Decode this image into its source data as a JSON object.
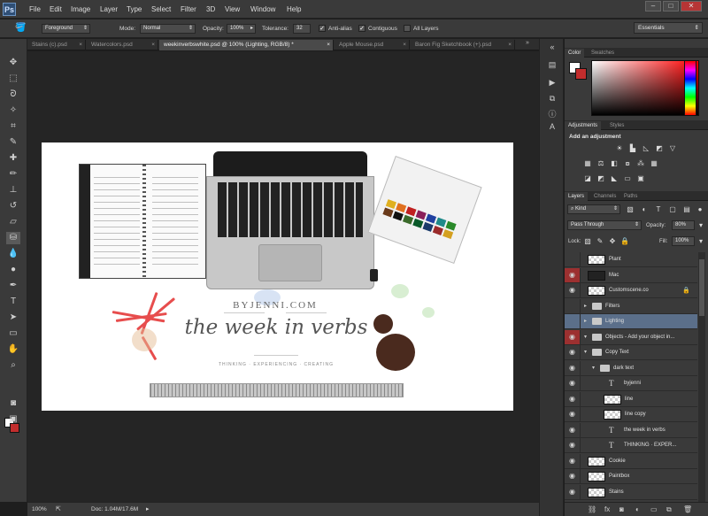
{
  "app": {
    "logo": "Ps"
  },
  "menu": [
    "File",
    "Edit",
    "Image",
    "Layer",
    "Type",
    "Select",
    "Filter",
    "3D",
    "View",
    "Window",
    "Help"
  ],
  "window_controls": {
    "minimize": "–",
    "maximize": "□",
    "close": "✕"
  },
  "options_bar": {
    "fill_source": "Foreground",
    "mode_label": "Mode:",
    "mode_value": "Normal",
    "opacity_label": "Opacity:",
    "opacity_value": "100%",
    "tolerance_label": "Tolerance:",
    "tolerance_value": "32",
    "anti_alias_label": "Anti-alias",
    "contiguous_label": "Contiguous",
    "all_layers_label": "All Layers",
    "anti_alias_checked": true,
    "contiguous_checked": true,
    "all_layers_checked": false
  },
  "workspace": "Essentials",
  "tabs": [
    {
      "label": "Stains (c).psd",
      "active": false
    },
    {
      "label": "Watercolors.psd",
      "active": false
    },
    {
      "label": "weekinverbswhite.psd @ 100% (Lighting, RGB/8) *",
      "active": true
    },
    {
      "label": "Apple Mouse.psd",
      "active": false
    },
    {
      "label": "Baron Fig Sketchbook (+).psd",
      "active": false
    }
  ],
  "tab_close": "×",
  "artwork": {
    "byline": "BYJENNI.COM",
    "title": "the week in verbs",
    "tagline": "THINKING · EXPERIENCING · CREATING"
  },
  "status": {
    "zoom": "100%",
    "doc": "Doc: 1.04M/17.6M"
  },
  "color_panel": {
    "tabs": [
      "Color",
      "Swatches"
    ]
  },
  "adjustments_panel": {
    "tabs": [
      "Adjustments",
      "Styles"
    ],
    "title": "Add an adjustment"
  },
  "layers_panel": {
    "tabs": [
      "Layers",
      "Channels",
      "Paths"
    ],
    "kind_label": "Kind",
    "blend_mode": "Pass Through",
    "opacity_label": "Opacity:",
    "opacity_value": "80%",
    "lock_label": "Lock:",
    "fill_label": "Fill:",
    "fill_value": "100%",
    "layers": [
      {
        "name": "Plant",
        "visible": false,
        "type": "thumb"
      },
      {
        "name": "Mac",
        "visible": false,
        "type": "dark",
        "red": true
      },
      {
        "name": "Customscene.co",
        "visible": true,
        "type": "thumb",
        "locked": true
      },
      {
        "name": "Filters",
        "visible": false,
        "type": "folder"
      },
      {
        "name": "Lighting",
        "visible": false,
        "type": "folder",
        "selected": true
      },
      {
        "name": "Objects - Add your object in...",
        "visible": false,
        "type": "folder",
        "red": true,
        "open": true
      },
      {
        "name": "Copy Text",
        "visible": true,
        "type": "folder",
        "open": true
      },
      {
        "name": "dark text",
        "visible": true,
        "type": "folder",
        "open": true
      },
      {
        "name": "byjenni",
        "visible": true,
        "type": "text"
      },
      {
        "name": "line",
        "visible": true,
        "type": "thumb"
      },
      {
        "name": "line copy",
        "visible": true,
        "type": "thumb"
      },
      {
        "name": "the week in verbs",
        "visible": true,
        "type": "text"
      },
      {
        "name": "THINKING · EXPER...",
        "visible": true,
        "type": "text"
      },
      {
        "name": "Cookie",
        "visible": true,
        "type": "thumb"
      },
      {
        "name": "Paintbox",
        "visible": true,
        "type": "thumb"
      },
      {
        "name": "Stains",
        "visible": true,
        "type": "thumb"
      }
    ]
  },
  "colors": {
    "foreground": "#ffffff",
    "background": "#c22d2d",
    "selected_layer": "#5b6f8a",
    "hidden_marker": "#9c3030"
  }
}
